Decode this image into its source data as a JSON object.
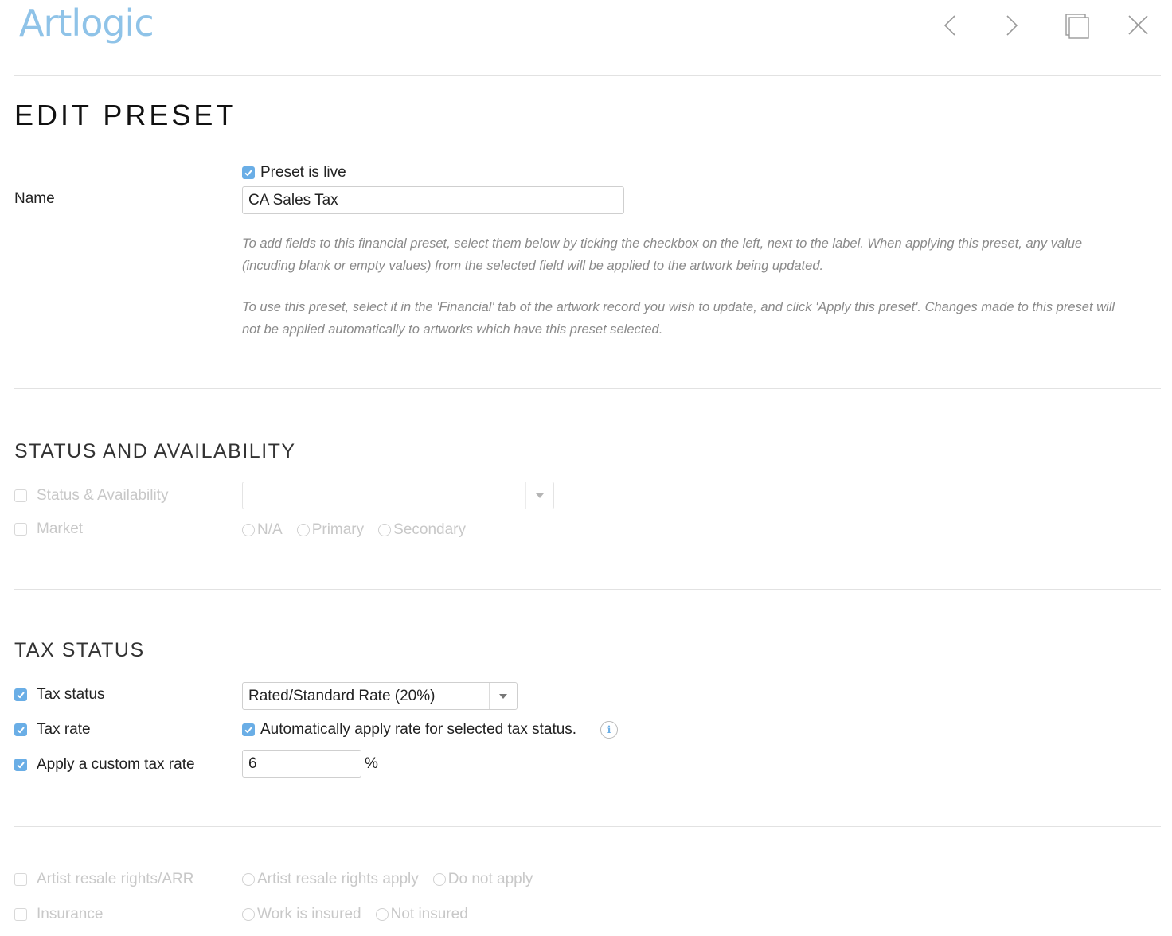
{
  "header": {
    "logo_text": "Artlogic"
  },
  "page_title": "EDIT PRESET",
  "preset": {
    "live_label": "Preset is live",
    "live_checked": true,
    "name_label": "Name",
    "name_value": "CA Sales Tax",
    "help_1": "To add fields to this financial preset, select them below by ticking the checkbox on the left, next to the label. When applying this preset, any value (incuding blank or empty values) from the selected field will be applied to the artwork being updated.",
    "help_2": "To use this preset, select it in the 'Financial' tab of the artwork record you wish to update, and click 'Apply this preset'. Changes made to this preset will not be applied automatically to artworks which have this preset selected."
  },
  "status_section": {
    "title": "STATUS AND AVAILABILITY",
    "status_label": "Status & Availability",
    "status_value": "",
    "market_label": "Market",
    "market_options": [
      "N/A",
      "Primary",
      "Secondary"
    ]
  },
  "tax_section": {
    "title": "TAX STATUS",
    "tax_status_label": "Tax status",
    "tax_status_value": "Rated/Standard Rate (20%)",
    "tax_rate_label": "Tax rate",
    "auto_apply_label": "Automatically apply rate for selected tax status.",
    "info_glyph": "i",
    "custom_rate_label": "Apply a custom tax rate",
    "custom_rate_value": "6",
    "percent_sign": "%"
  },
  "other_section": {
    "arr_label": "Artist resale rights/ARR",
    "arr_options": [
      "Artist resale rights apply",
      "Do not apply"
    ],
    "insurance_label": "Insurance",
    "insurance_options": [
      "Work is insured",
      "Not insured"
    ]
  },
  "colors": {
    "accent": "#6aaee6",
    "logo": "#8fc3e8",
    "disabled_text": "#c8c8c8",
    "help_text": "#8a8a8a"
  }
}
